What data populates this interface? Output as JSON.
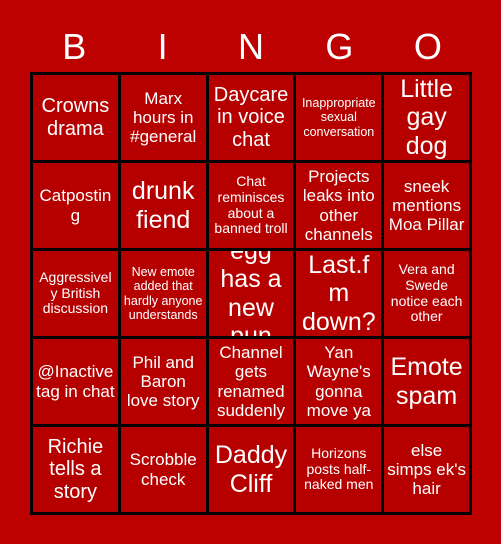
{
  "title": "BINGO",
  "colors": {
    "background": "#bd0000",
    "cell_fill": "#b60000",
    "grid_line": "#000000",
    "text": "#ffffff"
  },
  "header": {
    "letters": [
      "B",
      "I",
      "N",
      "G",
      "O"
    ]
  },
  "grid": {
    "rows": 5,
    "columns": 5,
    "cells": [
      [
        {
          "text": "Crowns drama",
          "size": "fs-lg"
        },
        {
          "text": "Marx hours in #general",
          "size": "fs-md"
        },
        {
          "text": "Daycare in voice chat",
          "size": "fs-lg"
        },
        {
          "text": "Inappropriate sexual conversation",
          "size": "fs-xs"
        },
        {
          "text": "Little gay dog",
          "size": "fs-xl"
        }
      ],
      [
        {
          "text": "Catposting",
          "size": "fs-md"
        },
        {
          "text": "drunk fiend",
          "size": "fs-xl"
        },
        {
          "text": "Chat reminisces about a banned troll",
          "size": "fs-sm"
        },
        {
          "text": "Projects leaks into other channels",
          "size": "fs-md"
        },
        {
          "text": "sneek mentions Moa Pillar",
          "size": "fs-md"
        }
      ],
      [
        {
          "text": "Aggressively British discussion",
          "size": "fs-sm"
        },
        {
          "text": "New emote added that hardly anyone understands",
          "size": "fs-xs"
        },
        {
          "text": "egg has a new pun",
          "size": "fs-xl"
        },
        {
          "text": "\"Is Last.fm down?\"",
          "size": "fs-xl"
        },
        {
          "text": "Vera and Swede notice each other",
          "size": "fs-sm"
        }
      ],
      [
        {
          "text": "@Inactive tag in chat",
          "size": "fs-md"
        },
        {
          "text": "Phil and Baron love story",
          "size": "fs-md"
        },
        {
          "text": "Channel gets renamed suddenly",
          "size": "fs-md"
        },
        {
          "text": "Yan Wayne's gonna move ya",
          "size": "fs-md"
        },
        {
          "text": "Emote spam",
          "size": "fs-xl"
        }
      ],
      [
        {
          "text": "Richie tells a story",
          "size": "fs-lg"
        },
        {
          "text": "Scrobble check",
          "size": "fs-md"
        },
        {
          "text": "Daddy Cliff",
          "size": "fs-xl"
        },
        {
          "text": "Horizons posts half-naked men",
          "size": "fs-sm"
        },
        {
          "text": "else simps ek's hair",
          "size": "fs-md"
        }
      ]
    ]
  }
}
